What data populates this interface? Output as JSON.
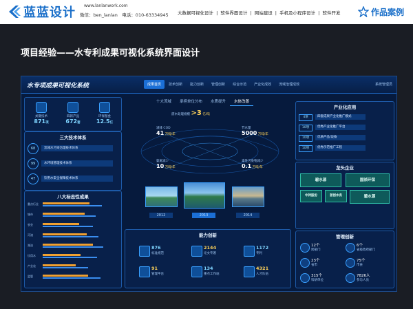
{
  "header": {
    "logo_text": "蓝蓝设计",
    "site_url": "www.lanlanwork.com",
    "contact": "微信：ben_lanlan　电话：010-63334945",
    "nav": [
      "大数据可视化设计",
      "|",
      "软件界面设计",
      "|",
      "网站建设",
      "|",
      "手机及小程序设计",
      "|",
      "软件开发"
    ],
    "cases_label": "作品案例"
  },
  "slide_title": "项目经验——水专利成果可视化系统界面设计",
  "dashboard": {
    "title": "水专项成果可视化系统",
    "tabs": [
      "成果首页",
      "技术创新",
      "能力创新",
      "管理创新",
      "综合示范",
      "产业化成效",
      "流域治理成效"
    ],
    "user": "系统管理员",
    "kpis": [
      {
        "label": "关键技术",
        "value": "871",
        "unit": "项"
      },
      {
        "label": "四新产品",
        "value": "672",
        "unit": "套"
      },
      {
        "label": "环保基金",
        "value": "12.5",
        "unit": "亿"
      }
    ],
    "systems_title": "三大技术体系",
    "systems": [
      {
        "num": "68",
        "label": "流域水污染治理技术体系"
      },
      {
        "num": "99",
        "label": "水环境管理技术体系"
      },
      {
        "num": "47",
        "label": "饮用水安全保障技术体系"
      }
    ],
    "indicators_title": "八大标志性成果",
    "indicators": [
      {
        "cat": "重点行业",
        "a": 0.62,
        "b": 0.78
      },
      {
        "cat": "城市",
        "a": 0.55,
        "b": 0.7
      },
      {
        "cat": "农业",
        "a": 0.48,
        "b": 0.66
      },
      {
        "cat": "河流",
        "a": 0.58,
        "b": 0.74
      },
      {
        "cat": "湖泊",
        "a": 0.66,
        "b": 0.8
      },
      {
        "cat": "饮用水",
        "a": 0.5,
        "b": 0.72
      },
      {
        "cat": "产业化",
        "a": 0.44,
        "b": 0.6
      },
      {
        "cat": "监管",
        "a": 0.6,
        "b": 0.76
      }
    ],
    "center_tabs": [
      "十大流域",
      "承担单位分布",
      "水质提升",
      "水体改善"
    ],
    "metrics": {
      "headline_label": "废水处理规模",
      "headline_value": ">3",
      "headline_unit": "亿/吨",
      "left_top": {
        "label": "减排 COD",
        "value": "41",
        "unit": "万吨/年"
      },
      "right_top": {
        "label": "节水量",
        "value": "5000",
        "unit": "万吨/年"
      },
      "left_bottom": {
        "label": "氨氮减少",
        "value": "10",
        "unit": "万吨/年"
      },
      "right_bottom": {
        "label": "毒性污染物减少",
        "value": "0.1",
        "unit": "万吨/年"
      }
    },
    "years": [
      "2012",
      "2013",
      "2014"
    ],
    "capability_title": "能力创新",
    "capability": [
      {
        "value": "876",
        "label": "标准规范",
        "color": "#7fd4ff"
      },
      {
        "value": "2144",
        "label": "论文专著",
        "color": "#ffd35a"
      },
      {
        "value": "1172",
        "label": "专利",
        "color": "#7fd4ff"
      },
      {
        "value": "91",
        "label": "管理平台",
        "color": "#ffd35a"
      },
      {
        "value": "134",
        "label": "重点工作站",
        "color": "#7fd4ff"
      },
      {
        "value": "4321",
        "label": "人才队伍",
        "color": "#ffd35a"
      }
    ],
    "industry_title": "产业化应用",
    "industry": [
      {
        "num": "4项",
        "label": "四套成果产业化推广模式"
      },
      {
        "num": "10项",
        "label": "优秀产业化推广平台"
      },
      {
        "num": "10项",
        "label": "优质产品/设备"
      },
      {
        "num": "10项",
        "label": "优秀示范推广工程"
      }
    ],
    "enterprise_title": "龙头企业",
    "enterprises": [
      "碧水源",
      "国祯环保",
      "中持股份",
      "首创水务",
      "碧水源"
    ],
    "mgmt_title": "管理创新",
    "management": [
      {
        "value": "12个",
        "label": "跨部门"
      },
      {
        "value": "6个",
        "label": "省级政府部门"
      },
      {
        "value": "23个",
        "label": "省市"
      },
      {
        "value": "75个",
        "label": "市县"
      },
      {
        "value": "315个",
        "label": "科研单位"
      },
      {
        "value": "7826人",
        "label": "参与人员"
      }
    ]
  }
}
